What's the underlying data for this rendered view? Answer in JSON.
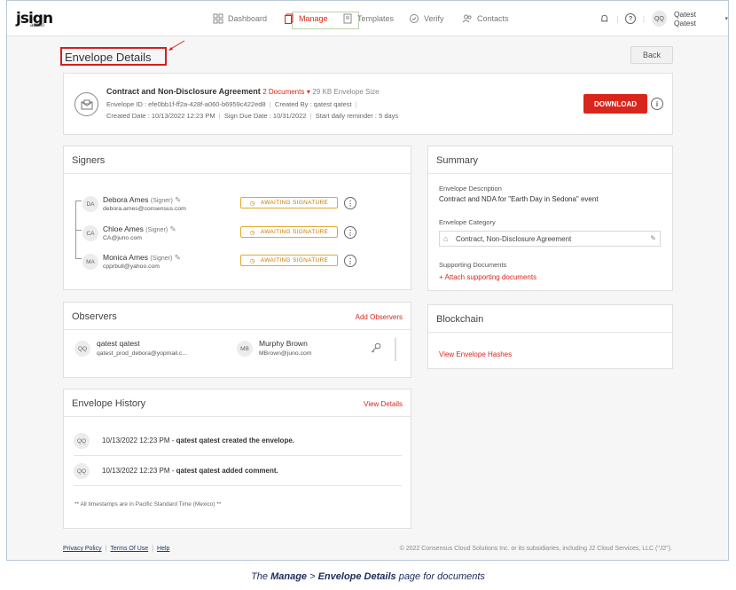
{
  "logo": {
    "text": "jsign",
    "sub": "admin"
  },
  "nav": {
    "dashboard": "Dashboard",
    "manage": "Manage",
    "templates": "Templates",
    "verify": "Verify",
    "contacts": "Contacts"
  },
  "user": {
    "initials": "QQ",
    "name": "Qatest Qatest"
  },
  "page": {
    "title": "Envelope Details",
    "back": "Back"
  },
  "envelope": {
    "name": "Contract and Non-Disclosure Agreement",
    "docs": "2 Documents",
    "size": "29 KB Envelope Size",
    "id_line": "Envelope ID : efe0bb1f-ff2a-428f-a060-b6959c422ed8",
    "created_by": "Created By : qatest qatest",
    "created_date": "Created Date : 10/13/2022 12:23 PM",
    "sign_due": "Sign Due Date : 10/31/2022",
    "reminder": "Start daily reminder : 5 days",
    "download": "DOWNLOAD"
  },
  "signers": {
    "title": "Signers",
    "items": [
      {
        "initials": "DA",
        "name": "Debora Ames",
        "role": "(Signer)",
        "email": "debora.ames@consensus.com",
        "status": "AWAITING SIGNATURE"
      },
      {
        "initials": "CA",
        "name": "Chloe Ames",
        "role": "(Signer)",
        "email": "CA@juno.com",
        "status": "AWAITING SIGNATURE"
      },
      {
        "initials": "MA",
        "name": "Monica Ames",
        "role": "(Signer)",
        "email": "cpprbull@yahoo.com",
        "status": "AWAITING SIGNATURE"
      }
    ]
  },
  "observers": {
    "title": "Observers",
    "add": "Add Observers",
    "items": [
      {
        "initials": "QQ",
        "name": "qatest qatest",
        "email": "qatest_prod_debora@yopmail.c..."
      },
      {
        "initials": "MB",
        "name": "Murphy Brown",
        "email": "MBrown@juno.com"
      }
    ]
  },
  "history": {
    "title": "Envelope History",
    "view": "View Details",
    "items": [
      {
        "initials": "QQ",
        "time": "10/13/2022 12:23 PM -",
        "text": "qatest qatest created the envelope."
      },
      {
        "initials": "QQ",
        "time": "10/13/2022 12:23 PM -",
        "text": "qatest qatest added comment."
      }
    ],
    "note": "** All timestamps are in Pacific Standard Time (Mexico) **"
  },
  "summary": {
    "title": "Summary",
    "desc_label": "Envelope Description",
    "desc_value": "Contract and NDA for \"Earth Day in Sedona\" event",
    "cat_label": "Envelope Category",
    "cat_value": "Contract, Non-Disclosure Agreement",
    "sup_label": "Supporting Documents",
    "sup_link": "+ Attach supporting documents"
  },
  "blockchain": {
    "title": "Blockchain",
    "link": "View Envelope Hashes"
  },
  "footer": {
    "privacy": "Privacy Policy",
    "terms": "Terms Of Use",
    "help": "Help",
    "copyright": "© 2022 Consensus Cloud Solutions Inc. or its subsidiaries, including J2 Cloud Services, LLC (\"J2\")."
  },
  "caption": {
    "pre": "The ",
    "manage": "Manage",
    "sep": " > ",
    "details": "Envelope Details",
    "post": " page for documents"
  },
  "colors": {
    "accent": "#d9261c",
    "status": "#e5a72a",
    "highlight": "#d31f1f"
  }
}
